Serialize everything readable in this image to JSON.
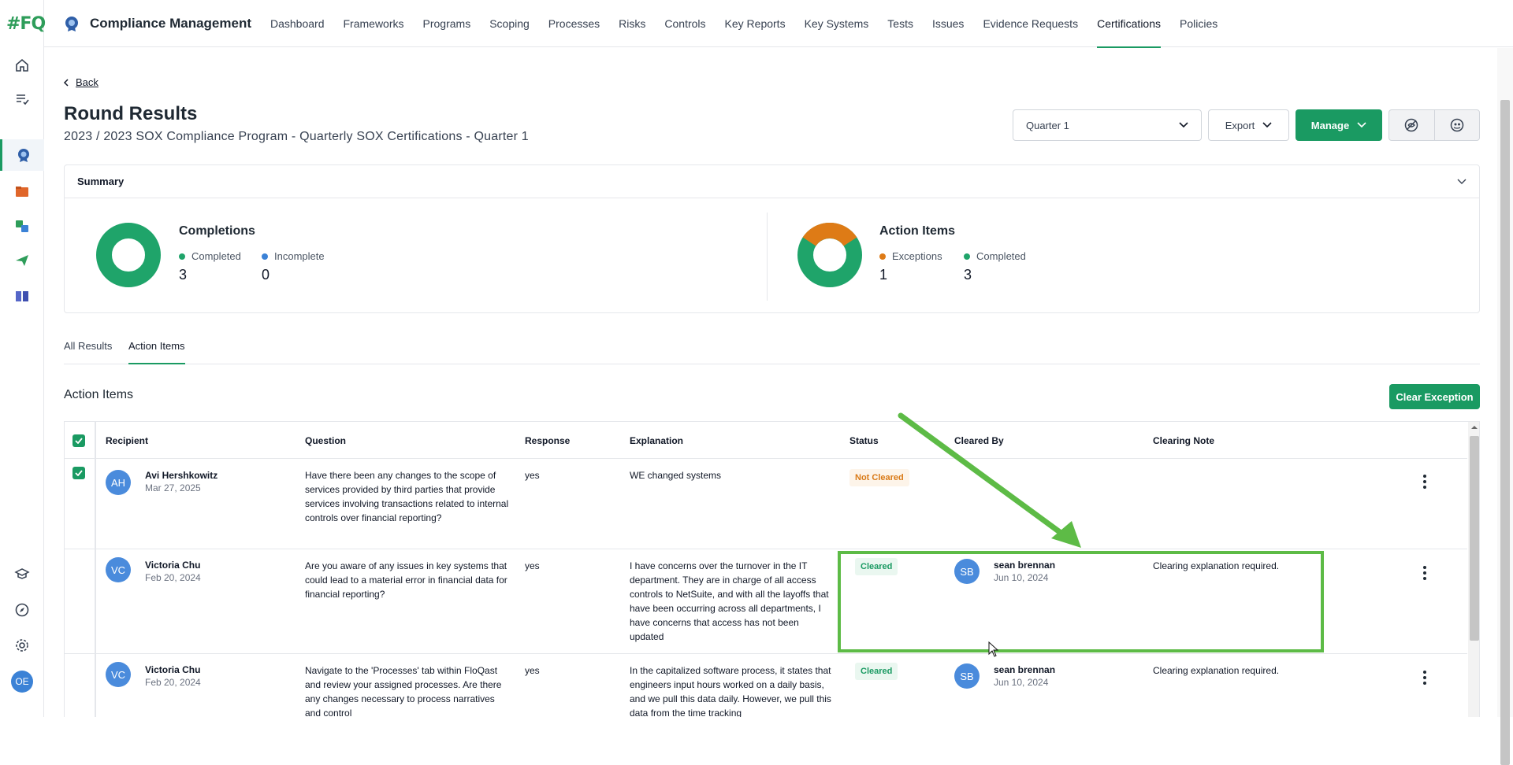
{
  "rail": {
    "logo": "#FQ",
    "items": [
      "home-icon",
      "tasks-icon",
      "certifications-icon",
      "folder-icon",
      "sync-icon",
      "send-icon",
      "book-icon",
      "learn-icon",
      "compass-icon",
      "settings-icon"
    ],
    "avatar_initials": "OE"
  },
  "topnav": {
    "app_title": "Compliance Management",
    "items": [
      "Dashboard",
      "Frameworks",
      "Programs",
      "Scoping",
      "Processes",
      "Risks",
      "Controls",
      "Key Reports",
      "Key Systems",
      "Tests",
      "Issues",
      "Evidence Requests",
      "Certifications",
      "Policies"
    ],
    "active_item": "Certifications"
  },
  "header": {
    "back_label": "Back",
    "title": "Round Results",
    "subtitle": "2023 / 2023 SOX Compliance Program - Quarterly SOX Certifications - Quarter 1",
    "quarter_select": "Quarter 1",
    "export_label": "Export",
    "manage_label": "Manage"
  },
  "summary": {
    "title": "Summary",
    "completions": {
      "title": "Completions",
      "completed_label": "Completed",
      "completed_value": "3",
      "incomplete_label": "Incomplete",
      "incomplete_value": "0"
    },
    "action_items": {
      "title": "Action Items",
      "exceptions_label": "Exceptions",
      "exceptions_value": "1",
      "completed_label": "Completed",
      "completed_value": "3"
    }
  },
  "colors": {
    "accent": "#1a9a62",
    "exception": "#de7b16",
    "incomplete": "#3b82d6",
    "annotation": "#5dbb46"
  },
  "tabs": [
    "All Results",
    "Action Items"
  ],
  "active_tab": "Action Items",
  "section": {
    "title": "Action Items",
    "clear_button": "Clear Exception"
  },
  "table": {
    "headers": [
      "Recipient",
      "Question",
      "Response",
      "Explanation",
      "Status",
      "Cleared By",
      "Clearing Note"
    ],
    "rows": [
      {
        "initials": "AH",
        "recipient": "Avi Hershkowitz",
        "date": "Mar 27, 2025",
        "question": "Have there been any changes to the scope of services provided by third parties that provide services involving transactions related to internal controls over financial reporting?",
        "response": "yes",
        "explanation": "WE changed systems",
        "status": "Not Cleared",
        "cleared_by_initials": "",
        "cleared_by": "",
        "cleared_date": "",
        "note": ""
      },
      {
        "initials": "VC",
        "recipient": "Victoria Chu",
        "date": "Feb 20, 2024",
        "question": "Are you aware of any issues in key systems that could lead to a material error in financial data for financial reporting?",
        "response": "yes",
        "explanation": "I have concerns over the turnover in the IT department. They are in charge of all access controls to NetSuite, and with all the layoffs that have been occurring across all departments, I have concerns that access has not been updated",
        "status": "Cleared",
        "cleared_by_initials": "SB",
        "cleared_by": "sean brennan",
        "cleared_date": "Jun 10, 2024",
        "note": "Clearing explanation required."
      },
      {
        "initials": "VC",
        "recipient": "Victoria Chu",
        "date": "Feb 20, 2024",
        "question": "Navigate to the 'Processes' tab within FloQast and review your assigned processes. Are there any changes necessary to process narratives and control",
        "response": "yes",
        "explanation": "In the capitalized software process, it states that engineers input hours worked on a daily basis, and we pull this data daily. However, we pull this data from the time tracking",
        "status": "Cleared",
        "cleared_by_initials": "SB",
        "cleared_by": "sean brennan",
        "cleared_date": "Jun 10, 2024",
        "note": "Clearing explanation required."
      }
    ]
  }
}
